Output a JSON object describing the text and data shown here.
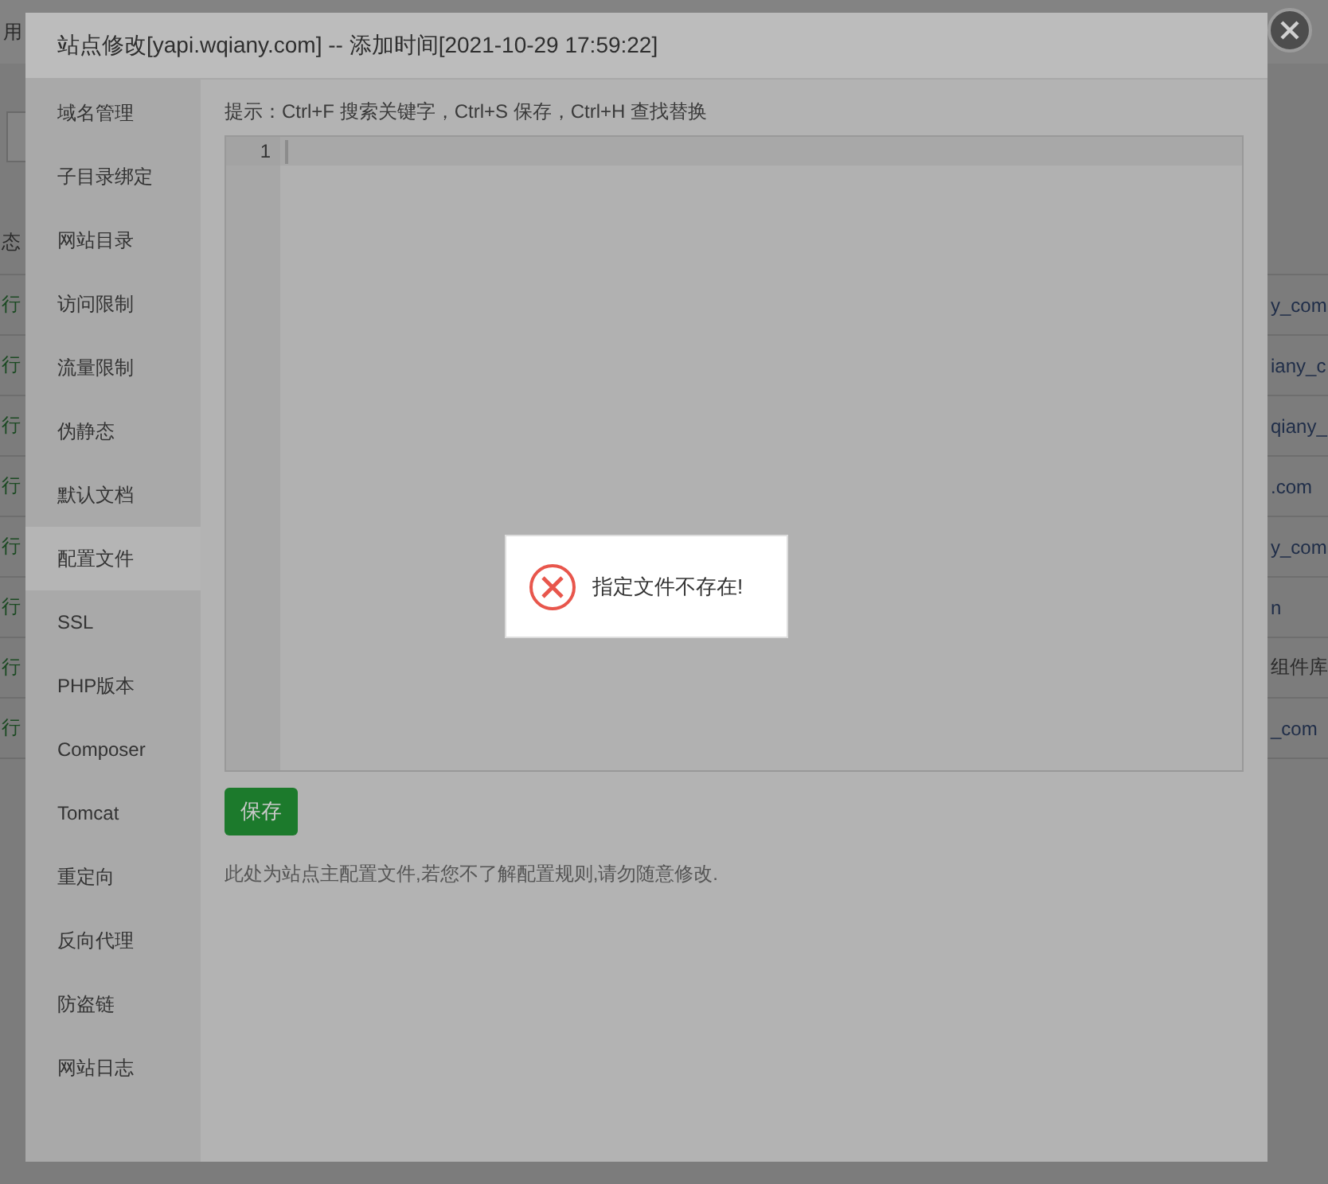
{
  "background_page": {
    "top_text": "用",
    "header_text": "态",
    "rows": [
      {
        "left": "行",
        "right": "y_com",
        "kind": "link"
      },
      {
        "left": "行",
        "right": "iany_c",
        "kind": "link"
      },
      {
        "left": "行",
        "right": "qiany_",
        "kind": "link"
      },
      {
        "left": "行",
        "right": ".com",
        "kind": "link"
      },
      {
        "left": "行",
        "right": "y_com",
        "kind": "link"
      },
      {
        "left": "行",
        "right": "n",
        "kind": "link"
      },
      {
        "left": "行",
        "right": "组件库",
        "kind": "text"
      },
      {
        "left": "行",
        "right": "_com",
        "kind": "link"
      }
    ]
  },
  "dialog": {
    "title": "站点修改[yapi.wqiany.com] -- 添加时间[2021-10-29 17:59:22]",
    "sidebar": {
      "items": [
        {
          "label": "域名管理",
          "selected": false
        },
        {
          "label": "子目录绑定",
          "selected": false
        },
        {
          "label": "网站目录",
          "selected": false
        },
        {
          "label": "访问限制",
          "selected": false
        },
        {
          "label": "流量限制",
          "selected": false
        },
        {
          "label": "伪静态",
          "selected": false
        },
        {
          "label": "默认文档",
          "selected": false
        },
        {
          "label": "配置文件",
          "selected": true
        },
        {
          "label": "SSL",
          "selected": false
        },
        {
          "label": "PHP版本",
          "selected": false
        },
        {
          "label": "Composer",
          "selected": false
        },
        {
          "label": "Tomcat",
          "selected": false
        },
        {
          "label": "重定向",
          "selected": false
        },
        {
          "label": "反向代理",
          "selected": false
        },
        {
          "label": "防盗链",
          "selected": false
        },
        {
          "label": "网站日志",
          "selected": false
        }
      ]
    },
    "hint": "提示：Ctrl+F 搜索关键字，Ctrl+S 保存，Ctrl+H 查找替换",
    "editor": {
      "line_numbers": [
        "1"
      ]
    },
    "save_button": "保存",
    "note": "此处为站点主配置文件,若您不了解配置规则,请勿随意修改."
  },
  "toast": {
    "message": "指定文件不存在!"
  }
}
